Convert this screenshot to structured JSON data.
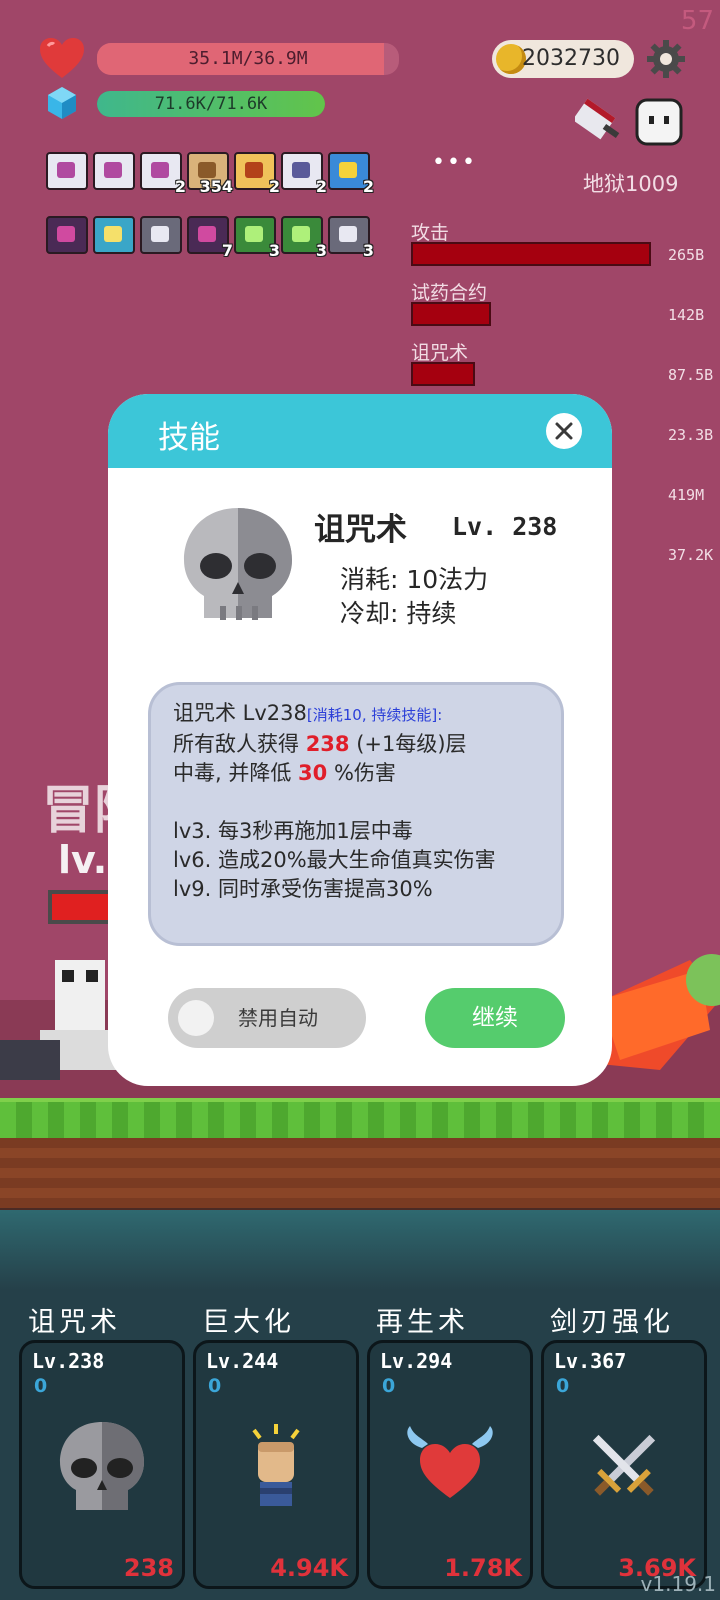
{
  "hud": {
    "fps": "57",
    "hp_text": "35.1M/36.9M",
    "hp_fraction": 0.951,
    "mp_text": "71.6K/71.6K",
    "mp_fraction": 1.0,
    "gold": "2032730",
    "hell_label": "地狱1009"
  },
  "buffs_row1": [
    {
      "icon": "scroll-icon",
      "count": ""
    },
    {
      "icon": "scroll-icon",
      "count": ""
    },
    {
      "icon": "scroll-icon",
      "count": "2"
    },
    {
      "icon": "wings-icon",
      "count": "354"
    },
    {
      "icon": "book-icon",
      "count": "2"
    },
    {
      "icon": "network-icon",
      "count": "2"
    },
    {
      "icon": "star-card-icon",
      "count": "2"
    }
  ],
  "buffs_row2": [
    {
      "icon": "demon-icon",
      "count": ""
    },
    {
      "icon": "bulb-icon",
      "count": ""
    },
    {
      "icon": "blade-icon",
      "count": ""
    },
    {
      "icon": "demon-icon",
      "count": "7"
    },
    {
      "icon": "heal-icon",
      "count": "3"
    },
    {
      "icon": "heal-icon",
      "count": "3"
    },
    {
      "icon": "blade-icon",
      "count": "3"
    }
  ],
  "more_dots": "•••",
  "damage": [
    {
      "label": "攻击",
      "value": "265B"
    },
    {
      "label": "试药合约",
      "value": "142B"
    },
    {
      "label": "诅咒术",
      "value": "87.5B"
    },
    {
      "label": "",
      "value": "23.3B"
    },
    {
      "label": "",
      "value": "419M"
    },
    {
      "label": "",
      "value": "37.2K"
    }
  ],
  "hero": {
    "name_partial": "冒险",
    "lv_partial": "lv."
  },
  "dialog": {
    "title": "技能",
    "skill_name": "诅咒术",
    "skill_lv": "Lv. 238",
    "cost": "消耗: 10法力",
    "cooldown": "冷却: 持续",
    "desc_head": "诅咒术 Lv238",
    "desc_tag": "[消耗10, 持续技能]:",
    "desc_line2_a": "所有敌人获得",
    "desc_line2_num": "238",
    "desc_line2_b": "(+1每级)层",
    "desc_line3_a": "中毒, 并降低",
    "desc_line3_num": "30",
    "desc_line3_b": "%伤害",
    "lv3": "lv3. 每3秒再施加1层中毒",
    "lv6": "lv6. 造成20%最大生命值真实伤害",
    "lv9": "lv9. 同时承受伤害提高30%",
    "toggle_label": "禁用自动",
    "continue_label": "继续"
  },
  "skills": [
    {
      "name": "诅咒术",
      "lv": "Lv.238",
      "zero": "0",
      "value": "238",
      "icon": "skull-icon"
    },
    {
      "name": "巨大化",
      "lv": "Lv.244",
      "zero": "0",
      "value": "4.94K",
      "icon": "fist-icon"
    },
    {
      "name": "再生术",
      "lv": "Lv.294",
      "zero": "0",
      "value": "1.78K",
      "icon": "winged-heart-icon"
    },
    {
      "name": "剑刃强化",
      "lv": "Lv.367",
      "zero": "0",
      "value": "3.69K",
      "icon": "crossed-swords-icon"
    }
  ],
  "version": "v1.19.1",
  "colors": {
    "accent": "#3cc6d8",
    "continue": "#55cc6d",
    "damage_bar": "#a5000f",
    "background": "#a04668"
  }
}
